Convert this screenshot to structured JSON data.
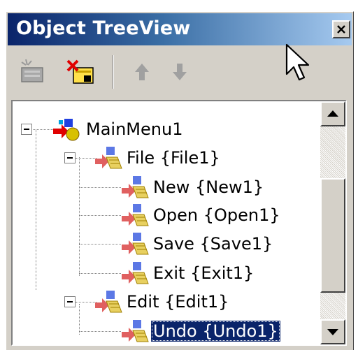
{
  "window": {
    "title": "Object TreeView",
    "close_glyph": "×"
  },
  "toolbar": {
    "buttons": [
      {
        "icon": "new-item-icon",
        "enabled": false
      },
      {
        "icon": "delete-item-icon",
        "enabled": true
      },
      {
        "icon": "move-up-icon",
        "enabled": false
      },
      {
        "icon": "move-down-icon",
        "enabled": false
      }
    ]
  },
  "tree": {
    "root": {
      "label": "MainMenu1",
      "icon": "main-menu-icon",
      "expanded": true
    },
    "items": [
      {
        "label": "File {File1}",
        "level": 1,
        "expanded": true
      },
      {
        "label": "New {New1}",
        "level": 2
      },
      {
        "label": "Open {Open1}",
        "level": 2
      },
      {
        "label": "Save {Save1}",
        "level": 2
      },
      {
        "label": "Exit {Exit1}",
        "level": 2
      },
      {
        "label": "Edit {Edit1}",
        "level": 1,
        "expanded": true
      },
      {
        "label": "Undo {Undo1}",
        "level": 2,
        "selected": true
      }
    ]
  },
  "colors": {
    "title_bar_start": "#0a246a",
    "title_bar_end": "#a6caf0",
    "selection": "#0a246a",
    "face": "#d4d0c8"
  }
}
